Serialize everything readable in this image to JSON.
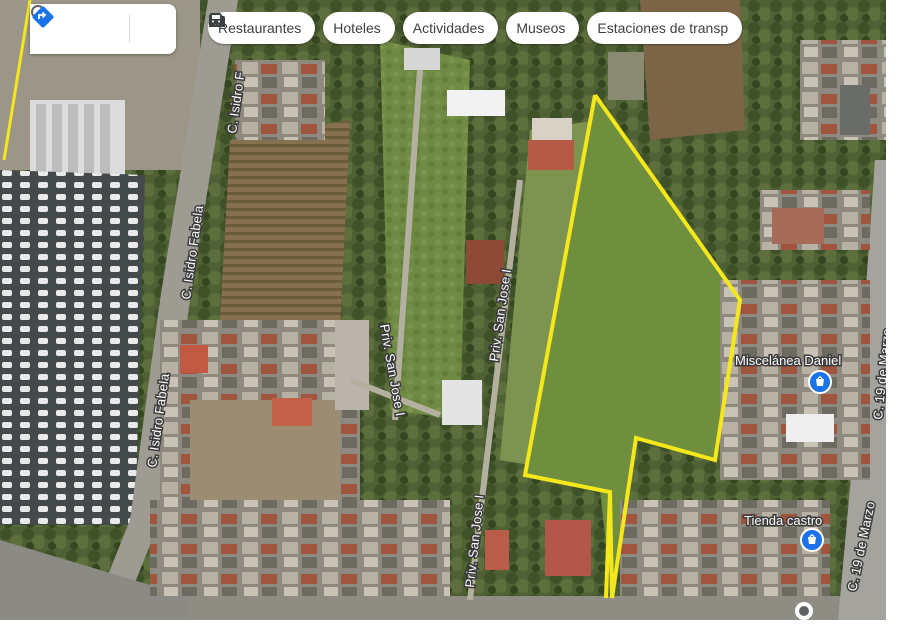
{
  "search": {
    "value": "",
    "placeholder": ""
  },
  "chips": [
    {
      "icon": "fork-knife-icon",
      "label": "Restaurantes"
    },
    {
      "icon": "bed-icon",
      "label": "Hoteles"
    },
    {
      "icon": "camera-icon",
      "label": "Actividades"
    },
    {
      "icon": "museum-icon",
      "label": "Museos"
    },
    {
      "icon": "train-icon",
      "label": "Estaciones de transp"
    }
  ],
  "streets": {
    "isidro_fabela_top": "C. Isidro F",
    "isidro_fabela_mid": "C. Isidro Fabela",
    "isidro_fabela_low": "C. Isidro Fabela",
    "san_jose_1": "Priv. San Jose I",
    "san_jose_2": "Priv. San Jose I",
    "san_jose_3": "Priv. San Jose I",
    "diez_nueve_marzo_top": "C. 19 de Marzo",
    "diez_nueve_marzo_bottom": "C. 19 de Marzo"
  },
  "places": {
    "miscelanea": "Miscelánea Daniel",
    "tienda": "Tienda castro"
  },
  "colors": {
    "outline": "#f4e71c",
    "poi_pin": "#1a73e8",
    "directions": "#1a73e8"
  }
}
